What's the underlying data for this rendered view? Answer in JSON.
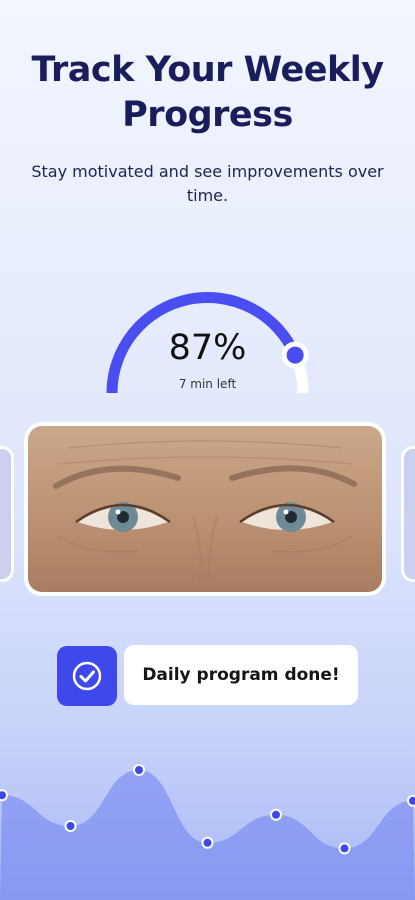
{
  "header": {
    "title_line1": "Track Your Weekly",
    "title_line2": "Progress",
    "subtitle": "Stay motivated and see improvements over time."
  },
  "progress": {
    "value": 0.87,
    "percent_label": "87%",
    "time_left": "7 min left",
    "color_active": "#4a4ef0",
    "color_track": "#ffffff"
  },
  "photo": {
    "icon": "eyes-closeup-photo"
  },
  "status": {
    "label": "Daily program done!",
    "icon": "check-circle-icon",
    "accent": "#3f48ea"
  },
  "chart_data": {
    "type": "area",
    "values": [
      62,
      40,
      80,
      28,
      48,
      24,
      58
    ]
  }
}
